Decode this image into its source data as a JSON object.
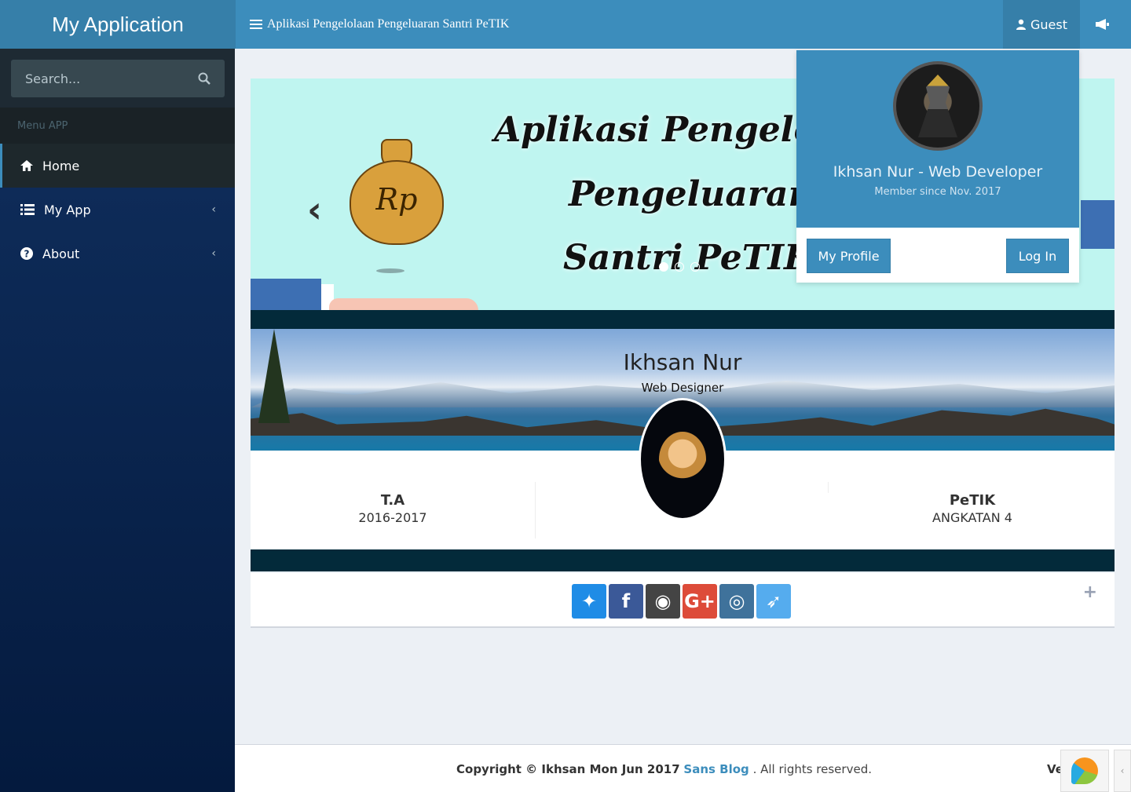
{
  "app": {
    "logo": "My Application",
    "page_title": "Aplikasi Pengelolaan Pengeluaran Santri PeTIK"
  },
  "header": {
    "user_label": "Guest",
    "user_icon": "user-icon",
    "notify_icon": "megaphone-icon"
  },
  "sidebar": {
    "search_placeholder": "Search...",
    "menu_header": "Menu APP",
    "items": [
      {
        "label": "Home",
        "icon": "home-icon",
        "active": true
      },
      {
        "label": "My App",
        "icon": "list-icon"
      },
      {
        "label": "About",
        "icon": "question-circle-icon"
      }
    ]
  },
  "carousel": {
    "lines": [
      "Aplikasi Pengelo",
      "Pengeluaran",
      "Santri PeTIK"
    ],
    "bag_label": "Rp"
  },
  "profile_widget": {
    "name": "Ikhsan Nur",
    "role": "Web Designer",
    "stats": [
      {
        "header": "T.A",
        "value": "2016-2017"
      },
      {
        "header": "PeTIK",
        "value": "ANGKATAN 4"
      }
    ]
  },
  "social": {
    "buttons": [
      {
        "name": "dropbox-icon",
        "color": "#1f8ce6",
        "glyph": "✦"
      },
      {
        "name": "facebook-icon",
        "color": "#3b5998",
        "glyph": "f"
      },
      {
        "name": "github-icon",
        "color": "#444444",
        "glyph": "◉"
      },
      {
        "name": "google-plus-icon",
        "color": "#dd4b39",
        "glyph": "G+"
      },
      {
        "name": "instagram-icon",
        "color": "#3f729b",
        "glyph": "◎"
      },
      {
        "name": "twitter-icon",
        "color": "#55acee",
        "glyph": "➶"
      }
    ]
  },
  "dropdown": {
    "name": "Ikhsan Nur - Web Developer",
    "since": "Member since Nov. 2017",
    "profile_button": "My Profile",
    "login_button": "Log In"
  },
  "footer": {
    "copyright_prefix": "Copyright © Ikhsan Mon Jun 2017",
    "link": "Sans Blog",
    "suffix": ". All rights reserved.",
    "version_label": "Ve"
  },
  "colors": {
    "header": "#3c8dbc",
    "logo_bg": "#367fa9",
    "sidebar": "#0c2a55",
    "content_bg": "#ecf0f5"
  }
}
